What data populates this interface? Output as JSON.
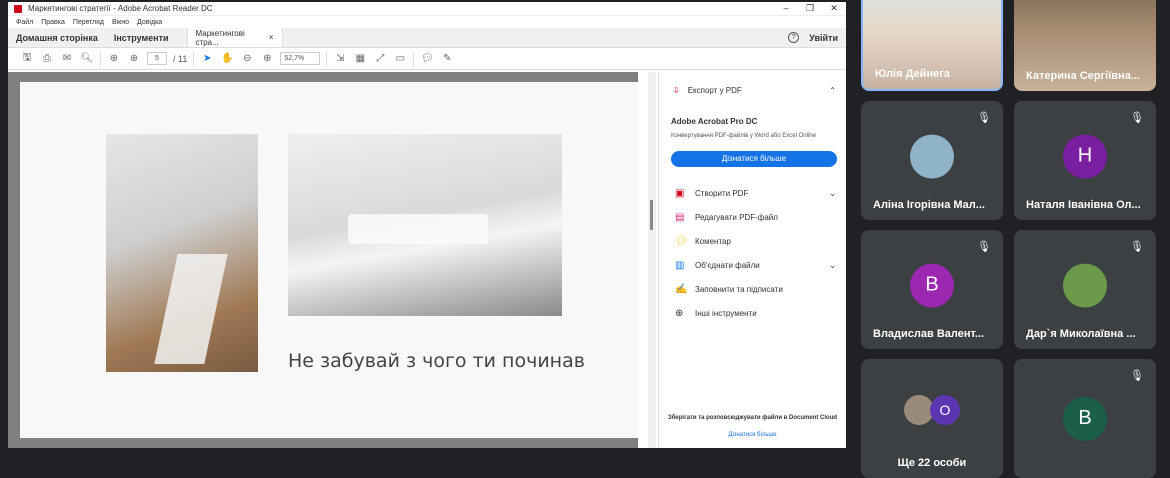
{
  "acrobat": {
    "window_title": "Маркетингові стратегії - Adobe Acrobat Reader DC",
    "menu": [
      "Файл",
      "Правка",
      "Перегляд",
      "Вікно",
      "Довідка"
    ],
    "tabs": {
      "home": "Домашня сторінка",
      "tools": "Інструменти",
      "document": "Маркетингові стра...",
      "close": "×"
    },
    "signin": "Увійти",
    "toolbar": {
      "page_current": "5",
      "page_total": "/ 11",
      "zoom": "52,7%"
    },
    "slide": {
      "text": "Не забувай з чого ти починав"
    },
    "right_pane": {
      "export_label": "Експорт у PDF",
      "product": "Adobe Acrobat Pro DC",
      "product_desc": "Конвертування PDF-файлів у Word або Excel Online",
      "learn_more_button": "Дізнатися більше",
      "tools": [
        {
          "label": "Створити PDF",
          "chevron": true
        },
        {
          "label": "Редагувати PDF-файл",
          "chevron": false
        },
        {
          "label": "Коментар",
          "chevron": false
        },
        {
          "label": "Об'єднати файли",
          "chevron": true
        },
        {
          "label": "Заповнити та підписати",
          "chevron": false
        },
        {
          "label": "Інші інструменти",
          "chevron": false
        }
      ],
      "footer_text": "Зберігати та розповсюджувати файли в Document Cloud",
      "footer_link": "Дізнатися більше"
    }
  },
  "meet": {
    "participants": [
      {
        "name": "Юлія Дейнега",
        "type": "video"
      },
      {
        "name": "Катерина Сергіївна...",
        "type": "video"
      },
      {
        "name": "Аліна Ігорівна Мал...",
        "type": "photo",
        "color": "#8fb3c9"
      },
      {
        "name": "Наталя Іванівна Ол...",
        "type": "letter",
        "letter": "Н",
        "color": "#7b1fa2"
      },
      {
        "name": "Владислав Валент...",
        "type": "letter",
        "letter": "В",
        "color": "#9c27b0"
      },
      {
        "name": "Дар`я Миколаївна ...",
        "type": "photo",
        "color": "#6a9a4a"
      },
      {
        "name": "Ще 22 особи",
        "type": "group",
        "letter": "О",
        "color": "#5e35b1"
      },
      {
        "name": "",
        "type": "letter",
        "letter": "В",
        "color": "#1b5e4a"
      }
    ]
  }
}
